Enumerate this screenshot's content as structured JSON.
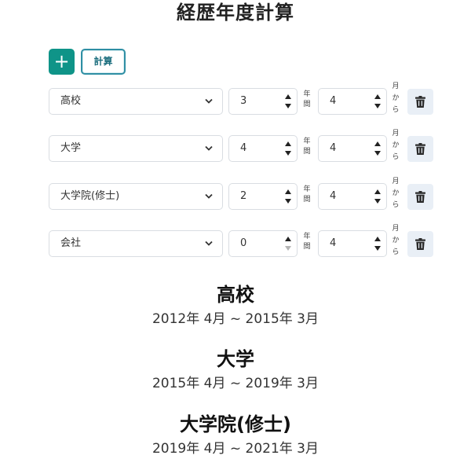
{
  "page": {
    "title": "経歴年度計算"
  },
  "toolbar": {
    "add_label": "+",
    "calc_label": "計算"
  },
  "units": {
    "year_1": "年",
    "year_2": "間",
    "month_1": "月",
    "month_2": "か",
    "month_3": "ら"
  },
  "rows": [
    {
      "type": "高校",
      "years": "3",
      "month": "4",
      "spin_down_enabled": true
    },
    {
      "type": "大学",
      "years": "4",
      "month": "4",
      "spin_down_enabled": true
    },
    {
      "type": "大学院(修士)",
      "years": "2",
      "month": "4",
      "spin_down_enabled": true
    },
    {
      "type": "会社",
      "years": "0",
      "month": "4",
      "spin_down_enabled": false
    }
  ],
  "results": [
    {
      "name": "高校",
      "range": "2012年 4月 ~ 2015年 3月"
    },
    {
      "name": "大学",
      "range": "2015年 4月 ~ 2019年 3月"
    },
    {
      "name": "大学院(修士)",
      "range": "2019年 4月 ~ 2021年 3月"
    }
  ],
  "colors": {
    "accent": "#0f9488",
    "calc_border": "#2f8fa4",
    "delete_bg": "#e9eff6",
    "border": "#d9dde2"
  },
  "icons": {
    "add": "plus-icon",
    "delete": "trash-icon",
    "select": "chevron-down-icon",
    "spinner": "spinner-arrows-icon"
  }
}
